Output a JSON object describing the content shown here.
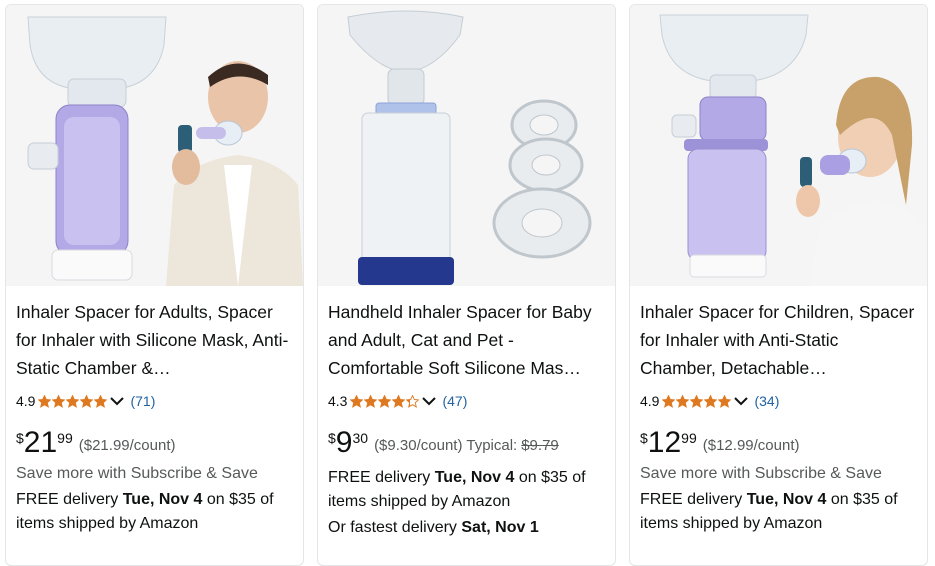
{
  "colors": {
    "star": "#DE7921",
    "link": "#2162A1",
    "muted": "#565959",
    "text": "#0F1111"
  },
  "products": [
    {
      "title": "Inhaler Spacer for Adults, Spacer for Inhaler with Silicone Mask, Anti-Static Chamber & Detachable Design",
      "title_display": "Inhaler Spacer for Adults, Spacer for Inhaler with Silicone Mask, Anti-Static Chamber &…",
      "rating": "4.9",
      "stars": 4.9,
      "review_count": "(71)",
      "price_symbol": "$",
      "price_whole": "21",
      "price_fraction": "99",
      "unit_price": "($21.99/count)",
      "typical_label": "",
      "typical_price": "",
      "subscribe": "Save more with Subscribe & Save",
      "delivery_prefix": "FREE delivery ",
      "delivery_date": "Tue, Nov 4",
      "delivery_suffix": " on $35 of items shipped by Amazon",
      "fast_prefix": "",
      "fast_date": ""
    },
    {
      "title": "Handheld Inhaler Spacer for Baby and Adult, Cat and Pet - Comfortable Soft Silicone Mask",
      "title_display": "Handheld Inhaler Spacer for Baby and Adult, Cat and Pet - Comfortable Soft Silicone Mas…",
      "rating": "4.3",
      "stars": 4.3,
      "review_count": "(47)",
      "price_symbol": "$",
      "price_whole": "9",
      "price_fraction": "30",
      "unit_price": "($9.30/count)",
      "typical_label": "Typical:",
      "typical_price": "$9.79",
      "subscribe": "",
      "delivery_prefix": "FREE delivery ",
      "delivery_date": "Tue, Nov 4",
      "delivery_suffix": " on $35 of items shipped by Amazon",
      "fast_prefix": "Or fastest delivery ",
      "fast_date": "Sat, Nov 1"
    },
    {
      "title": "Inhaler Spacer for Children, Spacer for Inhaler with Anti-Static Chamber, Detachable Design",
      "title_display": "Inhaler Spacer for Children, Spacer for Inhaler with Anti-Static Chamber, Detachable…",
      "rating": "4.9",
      "stars": 4.9,
      "review_count": "(34)",
      "price_symbol": "$",
      "price_whole": "12",
      "price_fraction": "99",
      "unit_price": "($12.99/count)",
      "typical_label": "",
      "typical_price": "",
      "subscribe": "Save more with Subscribe & Save",
      "delivery_prefix": "FREE delivery ",
      "delivery_date": "Tue, Nov 4",
      "delivery_suffix": " on $35 of items shipped by Amazon",
      "fast_prefix": "",
      "fast_date": ""
    }
  ]
}
